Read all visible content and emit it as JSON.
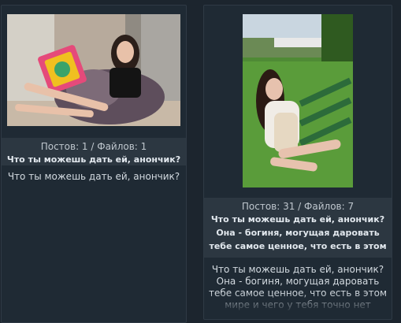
{
  "threads": [
    {
      "image_alt": "photo-1",
      "counts": "Постов: 1 / Файлов: 1",
      "subject": "Что ты можешь дать ей, анончик?",
      "body": "Что ты можешь дать ей, анончик?"
    },
    {
      "image_alt": "photo-2",
      "counts": "Постов: 31 / Файлов: 7",
      "subject": "Что ты можешь дать ей, анончик? Она - богиня, могущая даровать тебе самое ценное, что есть в этом ми",
      "body": "Что ты можешь дать ей, анончик? Она - богиня, могущая даровать тебе самое ценное, что есть в этом мире и чего у тебя точно нет"
    }
  ],
  "colors": {
    "background": "#1c252e",
    "card": "#1f2a34",
    "meta_bar": "#2c3741",
    "text": "#d3dae0"
  }
}
